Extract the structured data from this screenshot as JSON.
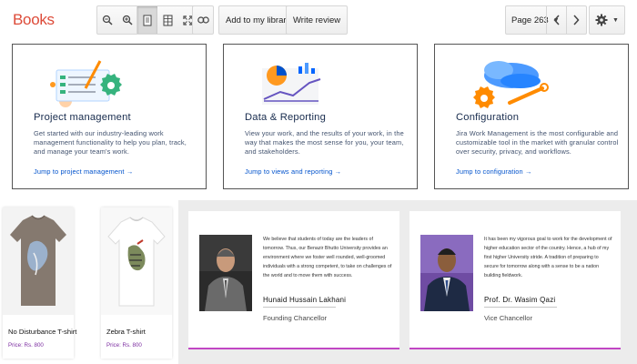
{
  "toolbar": {
    "logo": "Books",
    "add_library_label": "Add to my library",
    "write_review_label": "Write review",
    "page_label": "Page 263"
  },
  "cards": [
    {
      "title": "Project management",
      "description": "Get started with our industry-leading work management functionality to help you plan, track, and manage your team's work.",
      "link": "Jump to project management →"
    },
    {
      "title": "Data & Reporting",
      "description": "View your work, and the results of your work, in the way that makes the most sense for you, your team, and stakeholders.",
      "link": "Jump to views and reporting →"
    },
    {
      "title": "Configuration",
      "description": "Jira Work Management is the most configurable and customizable tool in the market with granular control over security, privacy, and workflows.",
      "link": "Jump to configuration →"
    }
  ],
  "products": [
    {
      "name": "No Disturbance T-shirt",
      "price": "Price: Rs. 800"
    },
    {
      "name": "Zebra T-shirt",
      "price": "Price: Rs. 800"
    }
  ],
  "profiles": [
    {
      "quote": "We believe that students of today are the leaders of tomorrow. Thus, our Benazir Bhutto University provides an environment where we foster well rounded, well-groomed individuals with a strong competent, to take on challenges of the world and to move them with success.",
      "name": "Hunaid Hussain Lakhani",
      "title": "Founding Chancellor"
    },
    {
      "quote": "It has been my vigorous goal to work for the development of higher education sector of the country. Hence, a hub of my first higher University stride. A tradition of preparing to secure for tomorrow along with a sense to be a nation building fieldwork.",
      "name": "Prof. Dr. Wasim Qazi",
      "title": "Vice Chancellor"
    }
  ],
  "colors": {
    "logo": "#dd4b39",
    "card_title": "#172b4d",
    "card_link": "#0052cc",
    "price": "#7b2ca0",
    "profile_accent": "#c146c4"
  },
  "icons": [
    "zoom-out-icon",
    "zoom-in-icon",
    "single-page-icon",
    "two-page-icon",
    "fullscreen-icon",
    "link-icon",
    "chevron-left-icon",
    "chevron-right-icon",
    "gear-icon"
  ]
}
